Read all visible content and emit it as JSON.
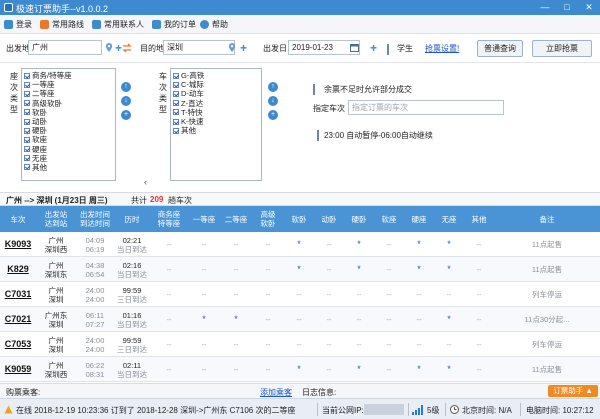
{
  "window": {
    "title": "极速订票助手--v1.0.0.2",
    "min": "—",
    "max": "□",
    "close": "✕"
  },
  "toolbar": [
    {
      "label": "登录",
      "icon": "login-icon",
      "color": "#3d8ad1"
    },
    {
      "label": "常用路线",
      "icon": "route-icon",
      "color": "#e57a2d"
    },
    {
      "label": "常用联系人",
      "icon": "contacts-icon",
      "color": "#3d8ad1"
    },
    {
      "label": "我的订单",
      "icon": "orders-icon",
      "color": "#3d8ad1"
    },
    {
      "label": "帮助",
      "icon": "help-icon",
      "color": "#3d8ad1"
    }
  ],
  "query": {
    "from_label": "出发地",
    "from_value": "广州",
    "to_label": "目的地",
    "to_value": "深圳",
    "swap_icon": "swap-icon",
    "date_label": "出发日",
    "date_value": "2019-01-23",
    "student_label": "学生",
    "student_checked": false,
    "settings_link": "抢票设置!",
    "normal_query": "普通查询",
    "grab_ticket": "立即抢票"
  },
  "filters": {
    "seat_vlabel": "座次类型",
    "seat_types": [
      {
        "label": "商务/特等座",
        "checked": true
      },
      {
        "label": "一等座",
        "checked": true
      },
      {
        "label": "二等座",
        "checked": true
      },
      {
        "label": "高级软卧",
        "checked": true
      },
      {
        "label": "软卧",
        "checked": true
      },
      {
        "label": "动卧",
        "checked": true
      },
      {
        "label": "硬卧",
        "checked": true
      },
      {
        "label": "软座",
        "checked": true
      },
      {
        "label": "硬座",
        "checked": true
      },
      {
        "label": "无座",
        "checked": true
      },
      {
        "label": "其他",
        "checked": true
      }
    ],
    "train_vlabel": "车次类型",
    "train_types": [
      {
        "label": "G-高铁",
        "checked": true
      },
      {
        "label": "C-城际",
        "checked": true
      },
      {
        "label": "D-动车",
        "checked": true
      },
      {
        "label": "Z-直达",
        "checked": true
      },
      {
        "label": "T-特快",
        "checked": true
      },
      {
        "label": "K-快速",
        "checked": true
      },
      {
        "label": "其他",
        "checked": true
      }
    ],
    "partial_success": {
      "label": "余票不足时允许部分成交",
      "checked": false
    },
    "specify_train_label": "指定车次",
    "specify_train_placeholder": "指定订票的车次",
    "pause_23": {
      "label": "23:00 自动暂停-06:00自动继续",
      "checked": false
    }
  },
  "route": {
    "route_text": "广州 --> 深圳 (1月23日 周三)",
    "total_prefix": "共计",
    "total_count": "209",
    "total_suffix": "趟车次"
  },
  "table": {
    "headers": [
      "车次",
      "出发站\n达到站",
      "出发时间\n到达时间",
      "历时",
      "商务座\n特等座",
      "一等座",
      "二等座",
      "高级\n软卧",
      "软卧",
      "动卧",
      "硬卧",
      "软座",
      "硬座",
      "无座",
      "其他",
      "备注"
    ],
    "rows": [
      {
        "code": "K9093",
        "from": "广州",
        "to": "深圳西",
        "dep": "04:09",
        "arr": "06:19",
        "dur": "02:21",
        "day": "当日到达",
        "seats": [
          "--",
          "--",
          "--",
          "--",
          "*",
          "--",
          "*",
          "--",
          "*",
          "*",
          "--"
        ],
        "note": "11点起售"
      },
      {
        "code": "K829",
        "from": "广州",
        "to": "深圳东",
        "dep": "04:38",
        "arr": "06:54",
        "dur": "02:16",
        "day": "当日到达",
        "seats": [
          "--",
          "--",
          "--",
          "--",
          "*",
          "--",
          "*",
          "--",
          "*",
          "*",
          "--"
        ],
        "note": "11点起售"
      },
      {
        "code": "C7031",
        "from": "广州",
        "to": "深圳",
        "dep": "24:00",
        "arr": "24:00",
        "dur": "99:59",
        "day": "三日到达",
        "seats": [
          "--",
          "--",
          "--",
          "--",
          "--",
          "--",
          "--",
          "--",
          "--",
          "--",
          "--"
        ],
        "note": "列车停运"
      },
      {
        "code": "C7021",
        "from": "广州东",
        "to": "深圳",
        "dep": "06:11",
        "arr": "07:27",
        "dur": "01:16",
        "day": "当日到达",
        "seats": [
          "--",
          "*",
          "*",
          "--",
          "--",
          "--",
          "--",
          "--",
          "--",
          "*",
          "--"
        ],
        "note": "11点30分起..."
      },
      {
        "code": "C7053",
        "from": "广州",
        "to": "深圳",
        "dep": "24:00",
        "arr": "24:00",
        "dur": "99:59",
        "day": "三日到达",
        "seats": [
          "--",
          "--",
          "--",
          "--",
          "--",
          "--",
          "--",
          "--",
          "--",
          "--",
          "--"
        ],
        "note": "列车停运"
      },
      {
        "code": "K9059",
        "from": "广州",
        "to": "深圳西",
        "dep": "06:22",
        "arr": "08:31",
        "dur": "02:11",
        "day": "当日到达",
        "seats": [
          "--",
          "--",
          "--",
          "--",
          "*",
          "--",
          "*",
          "--",
          "*",
          "*",
          "--"
        ],
        "note": "11点起售"
      }
    ]
  },
  "buybar": {
    "buyer_label": "购票乘客:",
    "add_passenger": "添加乘客",
    "log_label": "日志信息:",
    "grab_assistant": "订票助手 ▲"
  },
  "status": {
    "status_text": "在线 2018-12-19 10:23:36 订到了 2018-12-28 深圳->广州东 C7106 次的二等座",
    "ip_label": "当前公网IP:",
    "signal": "5级",
    "beijing_time": "北京时间: N/A",
    "pc_time": "电脑时间: 10:27:12"
  },
  "colors": {
    "accent": "#3d8ad1",
    "header": "#4a94d6",
    "link": "#1a55c9",
    "count": "#e03030",
    "orange": "#f08a24"
  }
}
